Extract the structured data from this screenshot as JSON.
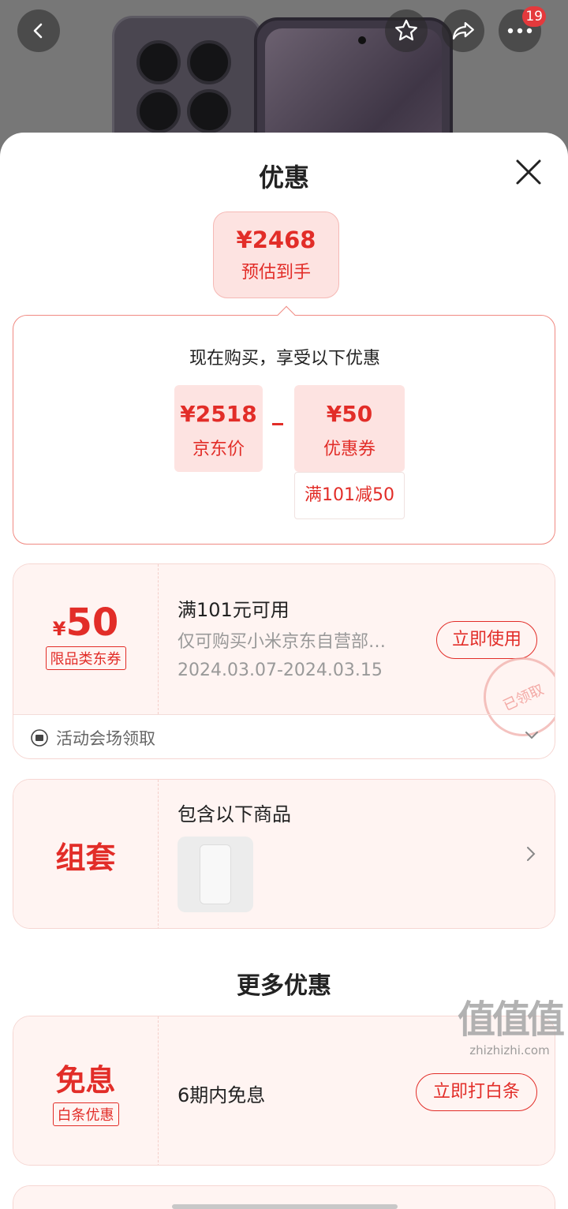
{
  "header": {
    "badge_count": "19"
  },
  "sheet": {
    "title": "优惠",
    "estimate": {
      "price": "¥2468",
      "label": "预估到手"
    },
    "calc": {
      "heading": "现在购买，享受以下优惠",
      "jd_price": {
        "price": "¥2518",
        "label": "京东价"
      },
      "coupon": {
        "price": "¥50",
        "label": "优惠券",
        "condition": "满101减50"
      }
    },
    "coupon_card": {
      "amount_symbol": "¥",
      "amount": "50",
      "tag": "限品类东券",
      "title": "满101元可用",
      "desc": "仅可购买小米京东自营部…",
      "date_range": "2024.03.07-2024.03.15",
      "button": "立即使用",
      "stamp": "已领取",
      "footer": "活动会场领取"
    },
    "bundle_card": {
      "left_label": "组套",
      "title": "包含以下商品"
    },
    "more_title": "更多优惠",
    "interest_card": {
      "left_label": "免息",
      "tag": "白条优惠",
      "title": "6期内免息",
      "button": "立即打白条"
    }
  },
  "watermark": {
    "text": "值值值",
    "domain": "zhizhizhi.com"
  },
  "colors": {
    "accent": "#e22d28",
    "light_pink": "#fde3e1",
    "card_bg": "#fff4f2"
  }
}
